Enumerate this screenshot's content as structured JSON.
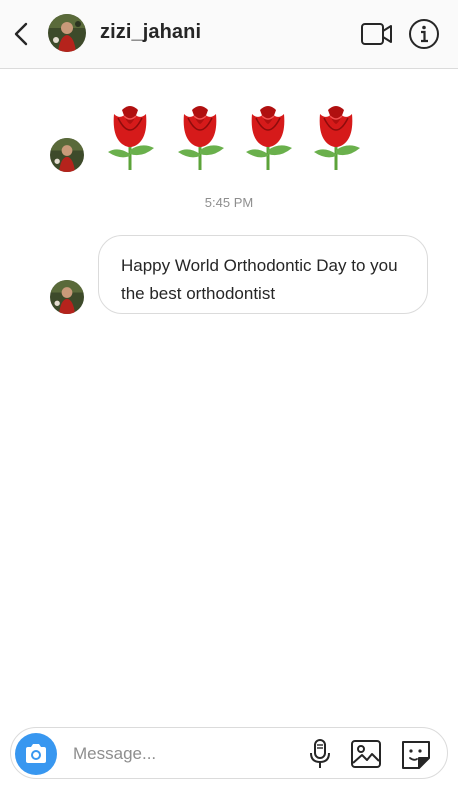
{
  "header": {
    "username": "zizi_jahani"
  },
  "thread": {
    "messages": [
      {
        "type": "emoji",
        "emoji": [
          "rose",
          "rose",
          "rose",
          "rose"
        ]
      },
      {
        "type": "text",
        "text": "Happy World Orthodontic Day to you the best orthodontist"
      }
    ],
    "timestamp": "5:45 PM"
  },
  "composer": {
    "placeholder": "Message..."
  },
  "colors": {
    "accent": "#3897f0",
    "rose": "#d61a1a",
    "leaf": "#6ab04c",
    "border": "#dbdbdb",
    "muted": "#8e8e8e"
  },
  "icons": [
    "back-icon",
    "video-call-icon",
    "info-icon",
    "camera-icon",
    "microphone-icon",
    "gallery-icon",
    "sticker-icon"
  ]
}
